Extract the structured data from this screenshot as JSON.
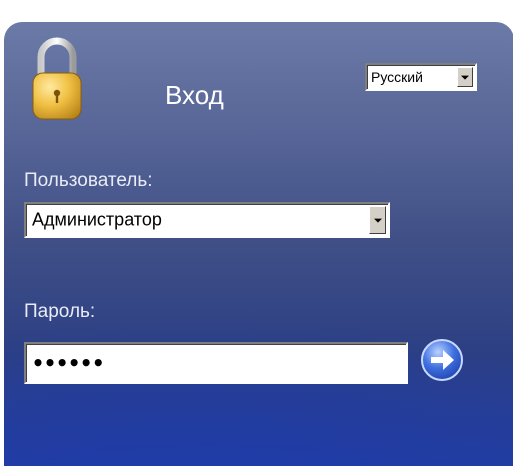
{
  "login": {
    "title": "Вход",
    "language": {
      "selected": "Русский"
    },
    "user": {
      "label": "Пользователь:",
      "selected": "Администратор"
    },
    "password": {
      "label": "Пароль:",
      "value": "••••••"
    }
  },
  "icons": {
    "lock": "lock-icon",
    "submit": "arrow-right-icon",
    "dropdown": "chevron-down-icon"
  },
  "colors": {
    "panel_top": "#6c7aa8",
    "panel_bottom": "#233da0",
    "lock_gold": "#e7b62b",
    "submit_blue": "#2e5fd6"
  }
}
